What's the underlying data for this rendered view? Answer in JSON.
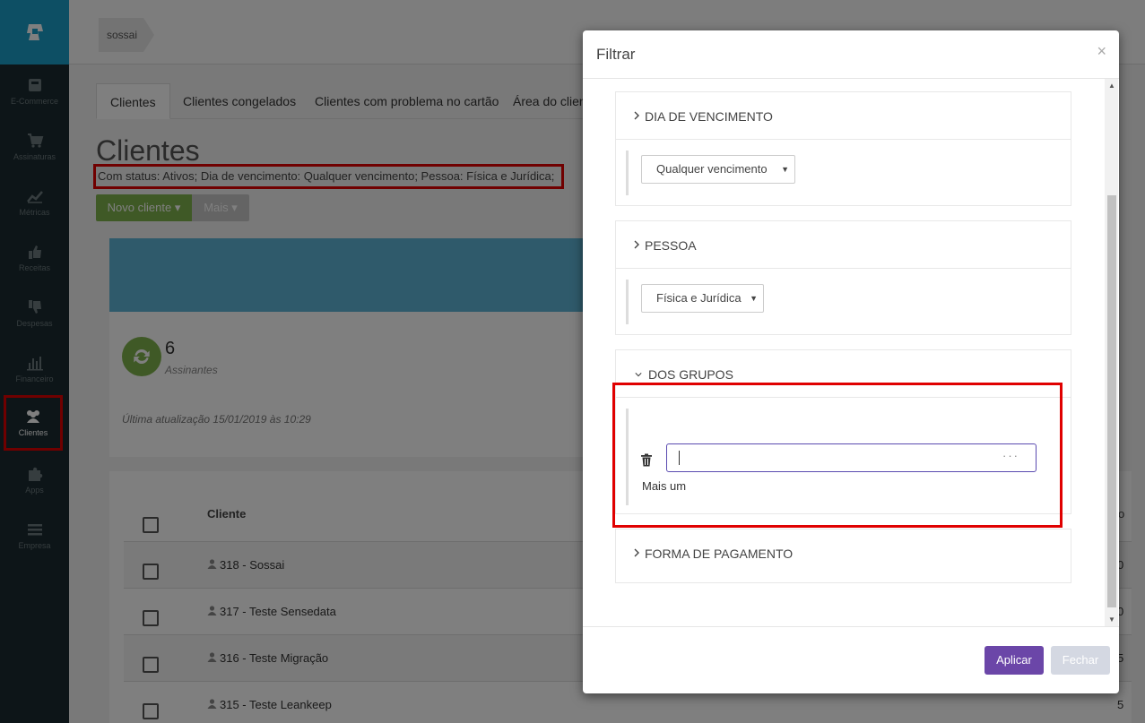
{
  "sidebar": {
    "items": [
      {
        "label": "E-Commerce",
        "icon": "basket-icon"
      },
      {
        "label": "Assinaturas",
        "icon": "cart-icon"
      },
      {
        "label": "Métricas",
        "icon": "chart-line-icon"
      },
      {
        "label": "Receitas",
        "icon": "thumbs-up-icon"
      },
      {
        "label": "Despesas",
        "icon": "thumbs-down-icon"
      },
      {
        "label": "Financeiro",
        "icon": "bar-chart-icon"
      },
      {
        "label": "Clientes",
        "icon": "users-icon"
      },
      {
        "label": "Apps",
        "icon": "puzzle-icon"
      },
      {
        "label": "Empresa",
        "icon": "menu-icon"
      }
    ]
  },
  "breadcrumb": {
    "label": "sossai"
  },
  "tabs": [
    {
      "label": "Clientes"
    },
    {
      "label": "Clientes congelados"
    },
    {
      "label": "Clientes com problema no cartão"
    },
    {
      "label": "Área do client"
    }
  ],
  "page": {
    "title": "Clientes",
    "status_text": "Com status: Ativos; Dia de vencimento: Qualquer vencimento; Pessoa: Física e Jurídica;",
    "novo_cliente_label": "Novo cliente",
    "mais_label": "Mais"
  },
  "summary": {
    "count": "6",
    "count_label": "Assinantes",
    "updated": "Última atualização 15/01/2019 às 10:29"
  },
  "table": {
    "header_client": "Cliente",
    "header_right": "o",
    "rows": [
      {
        "name": "318 - Sossai",
        "value": "0"
      },
      {
        "name": "317 - Teste Sensedata",
        "value": "0"
      },
      {
        "name": "316 - Teste Migração",
        "value": "5"
      },
      {
        "name": "315 - Teste Leankeep",
        "value": "5"
      }
    ]
  },
  "modal": {
    "title": "Filtrar",
    "close": "×",
    "sections": {
      "vencimento": {
        "title": "DIA DE VENCIMENTO",
        "value": "Qualquer vencimento"
      },
      "pessoa": {
        "title": "PESSOA",
        "value": "Física e Jurídica"
      },
      "grupos": {
        "title": "DOS GRUPOS",
        "input_value": "",
        "more_dots": "···",
        "add_more": "Mais um"
      },
      "pagamento": {
        "title": "FORMA DE PAGAMENTO"
      }
    },
    "apply_label": "Aplicar",
    "close_label": "Fechar"
  },
  "colors": {
    "sidebar_bg": "#1a2b30",
    "logo_bg": "#1b9fc9",
    "primary_button": "#6b46a8",
    "success": "#7fb24c",
    "highlight": "#e00000"
  }
}
